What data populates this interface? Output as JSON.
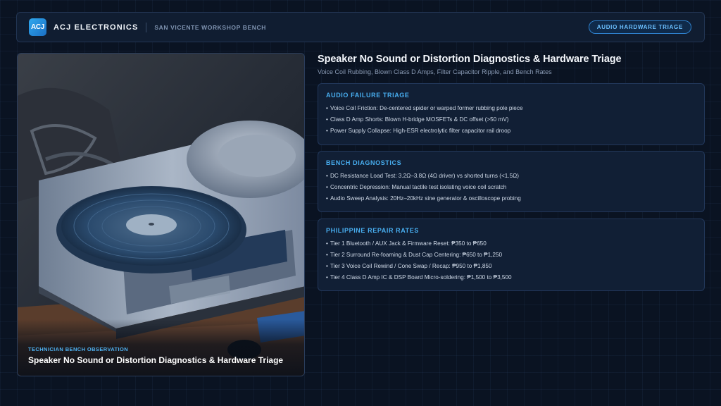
{
  "header": {
    "logo_text": "ACJ",
    "brand": "ACJ ELECTRONICS",
    "location": "SAN VICENTE WORKSHOP BENCH",
    "badge": "AUDIO HARDWARE TRIAGE"
  },
  "photo": {
    "kicker": "TECHNICIAN BENCH OBSERVATION",
    "title": "Speaker No Sound or Distortion Diagnostics & Hardware Triage"
  },
  "main": {
    "title": "Speaker No Sound or Distortion Diagnostics & Hardware Triage",
    "subtitle": "Voice Coil Rubbing, Blown Class D Amps, Filter Capacitor Ripple, and Bench Rates"
  },
  "panels": [
    {
      "heading": "AUDIO FAILURE TRIAGE",
      "items": [
        "Voice Coil Friction: De-centered spider or warped former rubbing pole piece",
        "Class D Amp Shorts: Blown H-bridge MOSFETs & DC offset (>50 mV)",
        "Power Supply Collapse: High-ESR electrolytic filter capacitor rail droop"
      ]
    },
    {
      "heading": "BENCH DIAGNOSTICS",
      "items": [
        "DC Resistance Load Test: 3.2Ω–3.8Ω (4Ω driver) vs shorted turns (<1.5Ω)",
        "Concentric Depression: Manual tactile test isolating voice coil scratch",
        "Audio Sweep Analysis: 20Hz–20kHz sine generator & oscilloscope probing"
      ]
    },
    {
      "heading": "PHILIPPINE REPAIR RATES",
      "items": [
        "Tier 1 Bluetooth / AUX Jack & Firmware Reset: ₱350 to ₱650",
        "Tier 2 Surround Re-foaming & Dust Cap Centering: ₱650 to ₱1,250",
        "Tier 3 Voice Coil Rewind / Cone Swap / Recap: ₱950 to ₱1,850",
        "Tier 4 Class D Amp IC & DSP Board Micro-soldering: ₱1,500 to ₱3,500"
      ]
    }
  ],
  "colors": {
    "accent": "#48aef0",
    "background": "#0a1322",
    "panel": "#111f35"
  }
}
